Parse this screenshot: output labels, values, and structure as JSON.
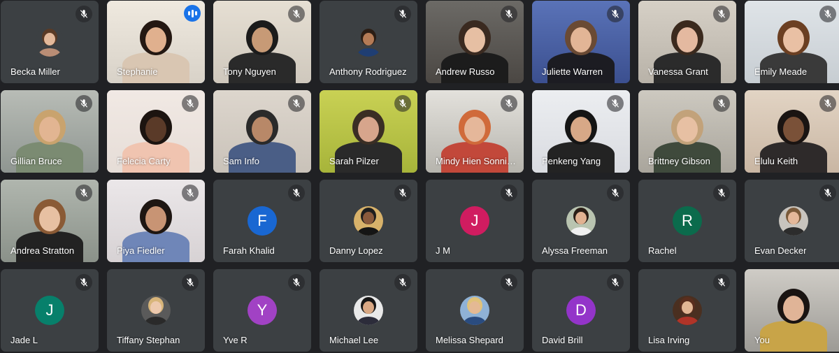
{
  "meeting": {
    "participants": [
      {
        "name": "Becka Miller",
        "muted": true,
        "kind": "avatar-photo",
        "bg": "#3c4043",
        "skin": "#e2b89a",
        "hair": "#5a3a25",
        "shirt": "#b98d75"
      },
      {
        "name": "Stephanie",
        "muted": false,
        "speaking": true,
        "kind": "video",
        "bg": "#d8d2c8",
        "skin": "#e0b08e",
        "hair": "#241812",
        "shirt": "#d9c6b2",
        "wall": "#efe9df"
      },
      {
        "name": "Tony Nguyen",
        "muted": true,
        "kind": "video",
        "bg": "#cfc8bd",
        "skin": "#c79a76",
        "hair": "#1b1b1b",
        "shirt": "#2a2a2a",
        "wall": "#e6dfd3"
      },
      {
        "name": "Anthony Rodriguez",
        "muted": true,
        "kind": "avatar-photo",
        "bg": "#3c4043",
        "skin": "#b47b56",
        "hair": "#2b1d14",
        "shirt": "#1f3e73"
      },
      {
        "name": "Andrew Russo",
        "muted": true,
        "kind": "video",
        "bg": "#4b4743",
        "skin": "#e6bfa3",
        "hair": "#3a2a20",
        "shirt": "#1c1c1c",
        "wall": "#6c6a66"
      },
      {
        "name": "Juliette Warren",
        "muted": true,
        "kind": "video",
        "bg": "#3b4f8f",
        "skin": "#e2b596",
        "hair": "#6a4a34",
        "shirt": "#1c1c22",
        "wall": "#5a73b8"
      },
      {
        "name": "Vanessa Grant",
        "muted": true,
        "kind": "video",
        "bg": "#b8b2a8",
        "skin": "#e4b9a0",
        "hair": "#3b2a1e",
        "shirt": "#2b2b2b",
        "wall": "#d6d0c6"
      },
      {
        "name": "Emily Meade",
        "muted": true,
        "kind": "video",
        "bg": "#c7cdd2",
        "skin": "#e9c0a4",
        "hair": "#6b3f22",
        "shirt": "#3a3a3a",
        "wall": "#dfe4e8"
      },
      {
        "name": "Gillian Bruce",
        "muted": true,
        "kind": "video",
        "bg": "#8f9691",
        "skin": "#e2b592",
        "hair": "#c9a36e",
        "shirt": "#7b8b72",
        "wall": "#b8bcb6"
      },
      {
        "name": "Felecia Carty",
        "muted": true,
        "kind": "video",
        "bg": "#e6ddd7",
        "skin": "#5a3a28",
        "hair": "#1c1410",
        "shirt": "#f0c4b0",
        "wall": "#f1e9e4"
      },
      {
        "name": "Sam Info",
        "muted": true,
        "kind": "video",
        "bg": "#c9c2b9",
        "skin": "#b88868",
        "hair": "#2a2a2a",
        "shirt": "#4a5e86",
        "wall": "#ddd6cd"
      },
      {
        "name": "Sarah Pilzer",
        "muted": true,
        "kind": "video",
        "bg": "#a7b43a",
        "skin": "#d7a58c",
        "hair": "#3a2e24",
        "shirt": "#2a2a2a",
        "wall": "#c9d154"
      },
      {
        "name": "Mindy Hien Sonnichsen",
        "muted": true,
        "kind": "video",
        "bg": "#b6b4ad",
        "skin": "#e5b79a",
        "hair": "#d06a3a",
        "shirt": "#c2483a",
        "wall": "#e3e1dc"
      },
      {
        "name": "Penkeng Yang",
        "muted": true,
        "kind": "video",
        "bg": "#d9dbe0",
        "skin": "#d7a887",
        "hair": "#151515",
        "shirt": "#232323",
        "wall": "#eceef1"
      },
      {
        "name": "Brittney Gibson",
        "muted": true,
        "kind": "video",
        "bg": "#a9a59c",
        "skin": "#e7c0a3",
        "hair": "#c2a27a",
        "shirt": "#3f4a3c",
        "wall": "#cdc9c0"
      },
      {
        "name": "Elulu Keith",
        "muted": true,
        "kind": "video",
        "bg": "#c9b6a3",
        "skin": "#7a5138",
        "hair": "#1a1412",
        "shirt": "#2e2a2a",
        "wall": "#e2d4c4"
      },
      {
        "name": "Andrea Stratton",
        "muted": true,
        "kind": "video",
        "bg": "#8a9189",
        "skin": "#e7c0a2",
        "hair": "#8a5a35",
        "shirt": "#222222",
        "wall": "#b0b6ae"
      },
      {
        "name": "Piya Fiedler",
        "muted": true,
        "kind": "video",
        "bg": "#d7d2d4",
        "skin": "#c89474",
        "hair": "#1e1612",
        "shirt": "#6f86b8",
        "wall": "#ebe7e9"
      },
      {
        "name": "Farah Khalid",
        "muted": true,
        "kind": "letter",
        "letter": "F",
        "color": "#1967d2"
      },
      {
        "name": "Danny Lopez",
        "muted": true,
        "kind": "avatar-photo",
        "bg": "#d8b26a",
        "skin": "#8a5a3c",
        "hair": "#1e1e1e",
        "shirt": "#151515"
      },
      {
        "name": "J M",
        "muted": true,
        "kind": "letter",
        "letter": "J",
        "color": "#d01c60"
      },
      {
        "name": "Alyssa Freeman",
        "muted": true,
        "kind": "avatar-photo",
        "bg": "#b9c4b0",
        "skin": "#e1b292",
        "hair": "#2a1e16",
        "shirt": "#f0f0f0"
      },
      {
        "name": "Rachel",
        "muted": true,
        "kind": "letter",
        "letter": "R",
        "color": "#0b6b4c"
      },
      {
        "name": "Evan Decker",
        "muted": true,
        "kind": "avatar-photo",
        "bg": "#c8c4be",
        "skin": "#e4b89a",
        "hair": "#7a5a3a",
        "shirt": "#2c2c2c"
      },
      {
        "name": "Jade L",
        "muted": true,
        "kind": "letter",
        "letter": "J",
        "color": "#07806b"
      },
      {
        "name": "Tiffany Stephan",
        "muted": true,
        "kind": "avatar-photo",
        "bg": "#5a5a5a",
        "skin": "#edc9ad",
        "hair": "#d8b57a",
        "shirt": "#2a2a2a"
      },
      {
        "name": "Yve R",
        "muted": true,
        "kind": "letter",
        "letter": "Y",
        "color": "#a142c4"
      },
      {
        "name": "Michael Lee",
        "muted": true,
        "kind": "avatar-photo",
        "bg": "#e9e9e9",
        "skin": "#d9a884",
        "hair": "#161616",
        "shirt": "#2c2c3a"
      },
      {
        "name": "Melissa Shepard",
        "muted": true,
        "kind": "avatar-photo",
        "bg": "#8fb2d6",
        "skin": "#e4b994",
        "hair": "#e0c27a",
        "shirt": "#2a4c80"
      },
      {
        "name": "David Brill",
        "muted": true,
        "kind": "letter",
        "letter": "D",
        "color": "#9334c9"
      },
      {
        "name": "Lisa Irving",
        "muted": true,
        "kind": "avatar-photo",
        "bg": "#4a2f20",
        "skin": "#e2b694",
        "hair": "#5a2e1e",
        "shirt": "#b03428"
      },
      {
        "name": "You",
        "muted": false,
        "kind": "video",
        "bg": "#9c9a95",
        "skin": "#e0b497",
        "hair": "#1a1412",
        "shirt": "#c8a448",
        "wall": "#cfccc6"
      }
    ]
  }
}
